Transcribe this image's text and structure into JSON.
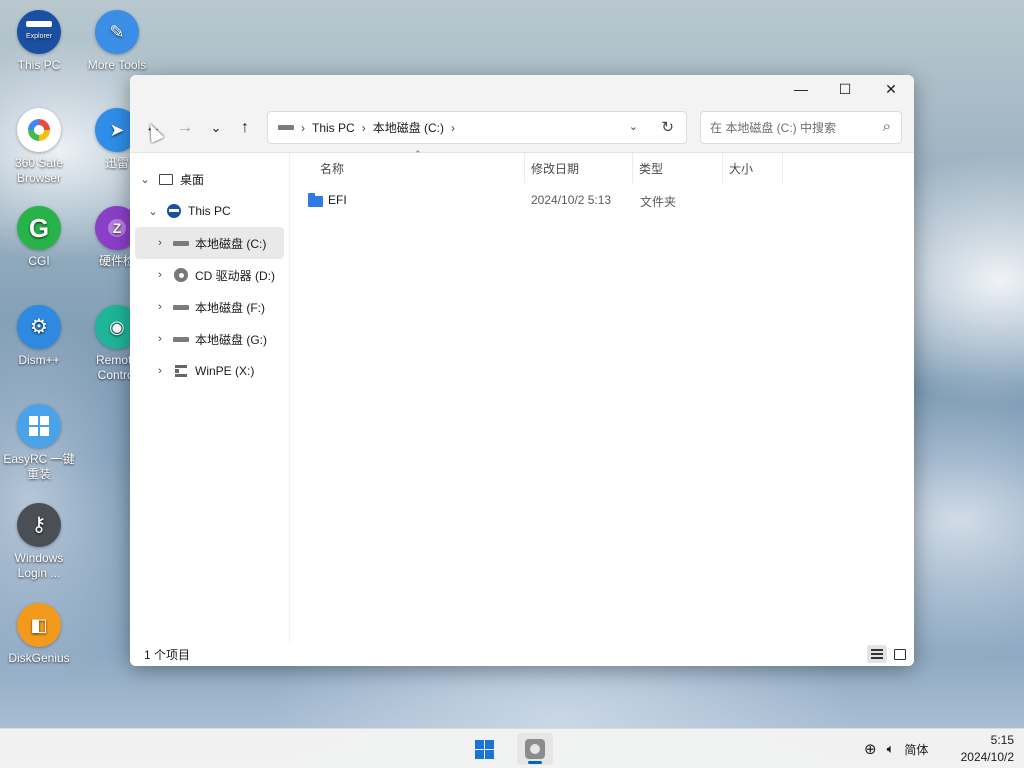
{
  "desktop": {
    "icons": [
      {
        "label": "This PC",
        "icon": "explorer-icon",
        "badge": "Explorer",
        "color": "#1a4fa3"
      },
      {
        "label": "More Tools",
        "icon": "wrench-icon",
        "color": "#3a8ee6"
      },
      {
        "label": "360 Safe Browser",
        "icon": "browser-360-icon",
        "color": "#ffffff"
      },
      {
        "label": "迅雷",
        "icon": "thunder-icon",
        "color": "#2f8ee8"
      },
      {
        "label": "CGI",
        "icon": "cgi-icon",
        "glyph": "G",
        "color": "#27b34a"
      },
      {
        "label": "硬件检",
        "icon": "hardware-check-icon",
        "glyph": "Z",
        "color": "#8a3fc7"
      },
      {
        "label": "Dism++",
        "icon": "gear-icon",
        "color": "#2d8ae0"
      },
      {
        "label": "Remote Control",
        "icon": "remote-icon",
        "color": "#1eb59a"
      },
      {
        "label": "EasyRC 一键重装",
        "icon": "windows-icon",
        "color": "#4aa3e8"
      },
      {
        "label": "Windows Login ...",
        "icon": "key-icon",
        "color": "#4a4e55"
      },
      {
        "label": "DiskGenius",
        "icon": "diskgenius-icon",
        "color": "#f29a1c"
      }
    ]
  },
  "window": {
    "title": "",
    "controls": {
      "minimize": "—",
      "maximize": "☐",
      "close": "✕"
    },
    "nav": {
      "back": "←",
      "forward": "→",
      "recent": "⌄",
      "up": "↑"
    },
    "address": {
      "segments": [
        "This PC",
        "本地磁盘 (C:)"
      ],
      "separator": "›"
    },
    "search": {
      "placeholder": "在 本地磁盘 (C:) 中搜索"
    },
    "tree": [
      {
        "label": "桌面",
        "icon": "desktop-icon",
        "chevron": "⌄",
        "expanded": true,
        "level": 0
      },
      {
        "label": "This PC",
        "icon": "this-pc-icon",
        "chevron": "⌄",
        "expanded": true,
        "level": 1
      },
      {
        "label": "本地磁盘 (C:)",
        "icon": "drive-icon",
        "chevron": "›",
        "level": 2,
        "selected": true
      },
      {
        "label": "CD 驱动器 (D:)",
        "icon": "cd-drive-icon",
        "chevron": "›",
        "level": 2
      },
      {
        "label": "本地磁盘 (F:)",
        "icon": "drive-icon",
        "chevron": "›",
        "level": 2
      },
      {
        "label": "本地磁盘 (G:)",
        "icon": "drive-icon",
        "chevron": "›",
        "level": 2
      },
      {
        "label": "WinPE (X:)",
        "icon": "winpe-drive-icon",
        "chevron": "›",
        "level": 2
      }
    ],
    "columns": {
      "name": "名称",
      "modified": "修改日期",
      "type": "类型",
      "size": "大小"
    },
    "files": [
      {
        "name": "EFI",
        "modified": "2024/10/2 5:13",
        "type": "文件夹",
        "size": ""
      }
    ],
    "status": {
      "count": "1 个项目"
    }
  },
  "taskbar": {
    "ime": "简体",
    "time": "5:15",
    "date": "2024/10/2"
  }
}
